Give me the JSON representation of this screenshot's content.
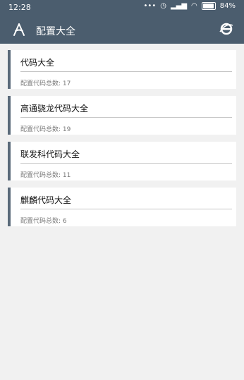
{
  "status_bar": {
    "time": "12:28",
    "battery": "84%",
    "signal_icons": [
      "more-icon",
      "clock-icon",
      "alarm-icon",
      "signal-icon",
      "signal-icon",
      "wifi-icon",
      "battery-icon"
    ]
  },
  "app_bar": {
    "title": "配置大全",
    "logo_icon": "compass-logo-icon",
    "browser_icon": "ie-browser-icon"
  },
  "items": [
    {
      "name": "代码大全",
      "count_label": "配置代码总数:",
      "count": "17"
    },
    {
      "name": "高通骁龙代码大全",
      "count_label": "配置代码总数:",
      "count": "19"
    },
    {
      "name": "联发科代码大全",
      "count_label": "配置代码总数:",
      "count": "11"
    },
    {
      "name": "麒麟代码大全",
      "count_label": "配置代码总数:",
      "count": "6"
    }
  ],
  "colors": {
    "header": "#4b5d6e",
    "card_accent": "#5a6a7a",
    "background": "#f1f1f1"
  }
}
